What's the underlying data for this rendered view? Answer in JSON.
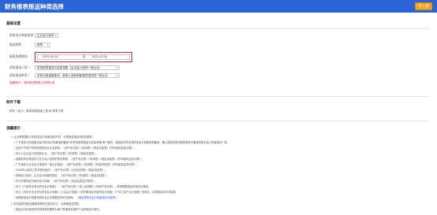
{
  "header": {
    "title": "财务报表报送种类选择",
    "next_label": "下一步"
  },
  "basic": {
    "section_title": "基础设置",
    "rows": [
      {
        "label": "财务会计制度准则",
        "value": "企业会计准则"
      },
      {
        "label": "报送频率",
        "value": "按季"
      },
      {
        "label": "报表所属期间",
        "start": "2021-01-01",
        "sep": "至",
        "end": "2021-12-31"
      },
      {
        "label": "资料报送小类 *",
        "value": "财务报表报送与信息采集（企业会计准则一般企业）"
      },
      {
        "label": "资料报送种类 *",
        "value": "未执行新金融准则、新收入准则和新租赁准则的一般企业"
      }
    ],
    "warning": "温馨提示：资料报送种类以选择为准"
  },
  "attachments": {
    "section_title": "附件下载",
    "text": "财务（会计）报表填报指南工具 和 样表下载"
  },
  "tips": {
    "section_title": "温馨提示",
    "lines": [
      "1. 企业需根据执行的财务会计制度准则不同，分别报送相应的财务报表。",
      "• 广东省执行的制度包括“财务会计制度准则备案”和“财务报表报送与信息采集”两个模块，报送前须先完成财务会计制度准则备案，确认报送的财务报表种类与备案的财务会计制度准则一致。",
      "• 适用于不属于所有制类型的企业及其他：《资产负债表》《利润表》《现金流量表》《所有者权益变动表》。",
      "• 执行小企业会计准则的企业：《资产负债表》《利润表》《现金流量表》。",
      "• 金融机构应报送执行企业会计准则的财务报表。《资产负债表》《利润表》《现金流量表》《所有者权益变动表》。",
      "• 广东省执行企业会计准则的一般企业报送：《资产负债表》《利润表》《现金流量表》《所有者权益变动表》。",
      "• 2006年以前成立的非营利组织：《资产负债表》《业务活动表》《现金流量表》。",
      "• 按照会计准则、企业会计制度的规定：《资产负债表》《利润表》《现金流量表》。",
      "• 执行村集体经济组织会计制度：《资产负债表》《收益及收益分配表》。",
      "• 执行《行政事业单位财务会计制度》：《资产负债表》《收入费用表》《净资产变动表》，其他需要报送的按实际报送。",
      "• 执行《农民专业合作社财务会计制度》《工会会计制度》《农村集体经济组织会计制度》《个体工商户会计制度》的单位，请按照实际情况填报。",
      "• 填报其他会计制度准则的企业请根据实际情况选择。",
      "2. 财务报表的报送期限按照有关规定执行，请参看报送须知。",
      "• 报送当月份报送的财务报表的期限为每个季度或年度终了后的规定时间内。"
    ],
    "link_text": "《报送须知及会计制度准则对照表》"
  },
  "icons": {
    "caret": "chevron-down-icon"
  },
  "colors": {
    "header_bg": "#2a64d8",
    "next_btn": "#f5a623",
    "highlight": "#e0212e"
  }
}
